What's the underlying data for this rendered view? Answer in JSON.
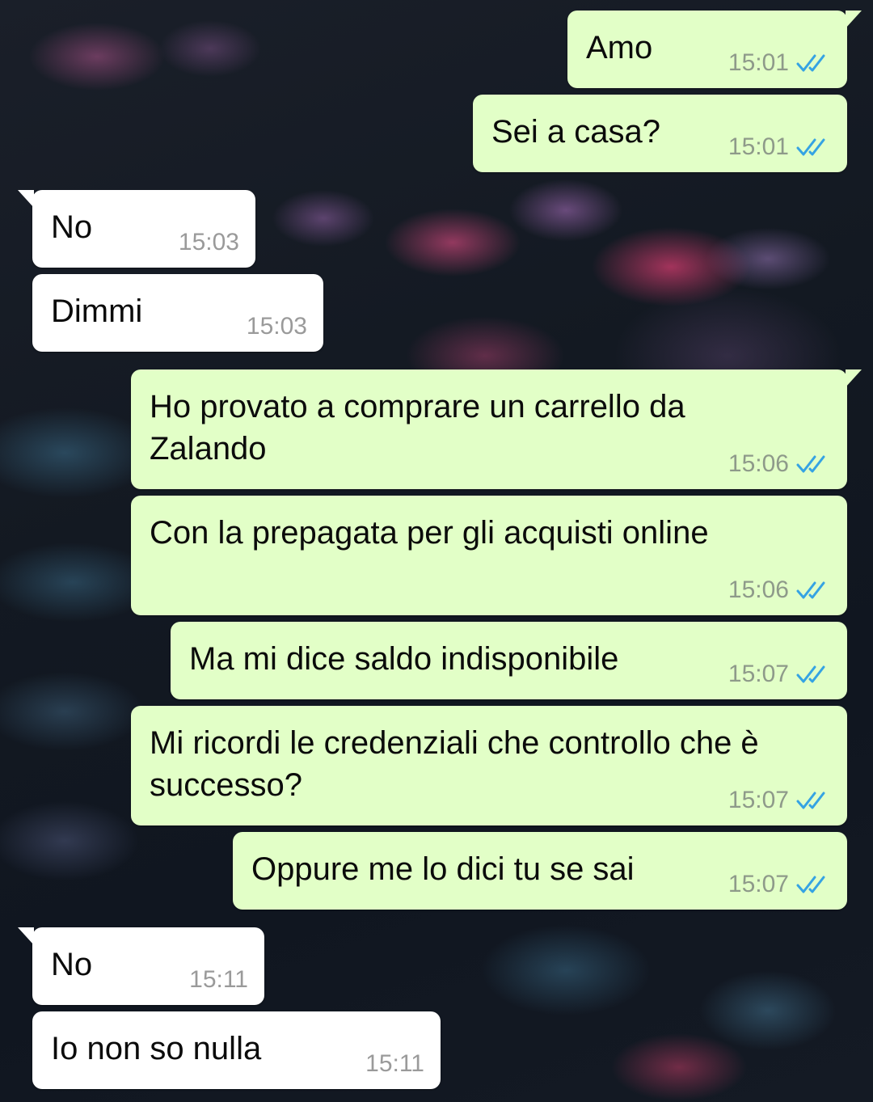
{
  "conversation": {
    "messages": [
      {
        "direction": "out",
        "text": "Amo",
        "time": "15:01",
        "status": "read"
      },
      {
        "direction": "out",
        "text": "Sei a casa?",
        "time": "15:01",
        "status": "read"
      },
      {
        "direction": "in",
        "text": "No",
        "time": "15:03"
      },
      {
        "direction": "in",
        "text": "Dimmi",
        "time": "15:03"
      },
      {
        "direction": "out",
        "text": "Ho provato a comprare un carrello da\nZalando",
        "time": "15:06",
        "status": "read"
      },
      {
        "direction": "out",
        "text": "Con la prepagata per gli acquisti online",
        "time": "15:06",
        "status": "read"
      },
      {
        "direction": "out",
        "text": "Ma mi dice saldo indisponibile",
        "time": "15:07",
        "status": "read"
      },
      {
        "direction": "out",
        "text": "Mi ricordi le credenziali che controllo che è\nsuccesso?",
        "time": "15:07",
        "status": "read"
      },
      {
        "direction": "out",
        "text": "Oppure me lo dici tu se sai",
        "time": "15:07",
        "status": "read"
      },
      {
        "direction": "in",
        "text": "No",
        "time": "15:11"
      },
      {
        "direction": "in",
        "text": "Io non so nulla",
        "time": "15:11"
      }
    ]
  },
  "colors": {
    "outgoing_bubble": "#e2ffc7",
    "incoming_bubble": "#ffffff",
    "read_ticks": "#35a3e3"
  },
  "icons": {
    "read_receipt": "double-check-icon"
  }
}
